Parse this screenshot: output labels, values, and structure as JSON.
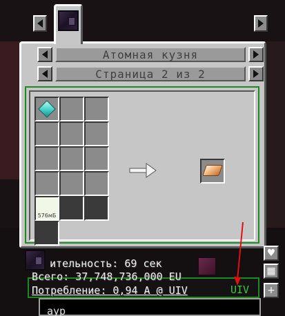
{
  "header": {
    "machine_name": "Атомная кузня",
    "page_label": "Страница 2 из 2"
  },
  "inputs": {
    "fluid_amount": "576мБ"
  },
  "info": {
    "duration": "ительность: 69 сек",
    "total": "Всего: 37,748,736,000 EU",
    "consumption": "Потребление: 0,94 A @ UIV",
    "tier": "UIV"
  },
  "search": {
    "value": "аур"
  },
  "icons": {
    "machine": "obsidian-machine-icon",
    "input": "diamond-dust-icon",
    "output": "orange-ingot-icon",
    "bookmark": "heart-icon",
    "sort": "grid-icon",
    "add": "plus-icon"
  },
  "colors": {
    "frame_green": "#1c8a1c",
    "tier_green": "#3ec83e",
    "annotation_red": "#e01010"
  }
}
